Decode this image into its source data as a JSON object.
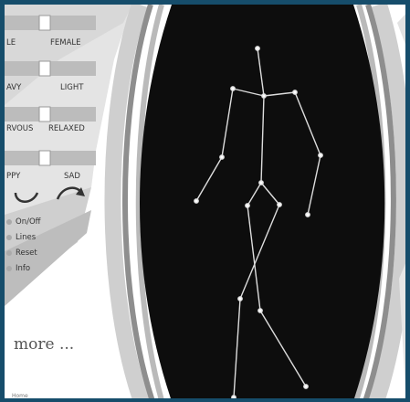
{
  "sliders": [
    {
      "left_label": "LE",
      "right_label": "FEMALE"
    },
    {
      "left_label": "AVY",
      "right_label": "LIGHT"
    },
    {
      "left_label": "RVOUS",
      "right_label": "RELAXED"
    },
    {
      "left_label": "PPY",
      "right_label": "SAD"
    }
  ],
  "toggles": [
    {
      "label": "On/Off"
    },
    {
      "label": "Lines"
    },
    {
      "label": "Reset"
    },
    {
      "label": "Info"
    }
  ],
  "more_link": "more ...",
  "footer_text": "Home"
}
